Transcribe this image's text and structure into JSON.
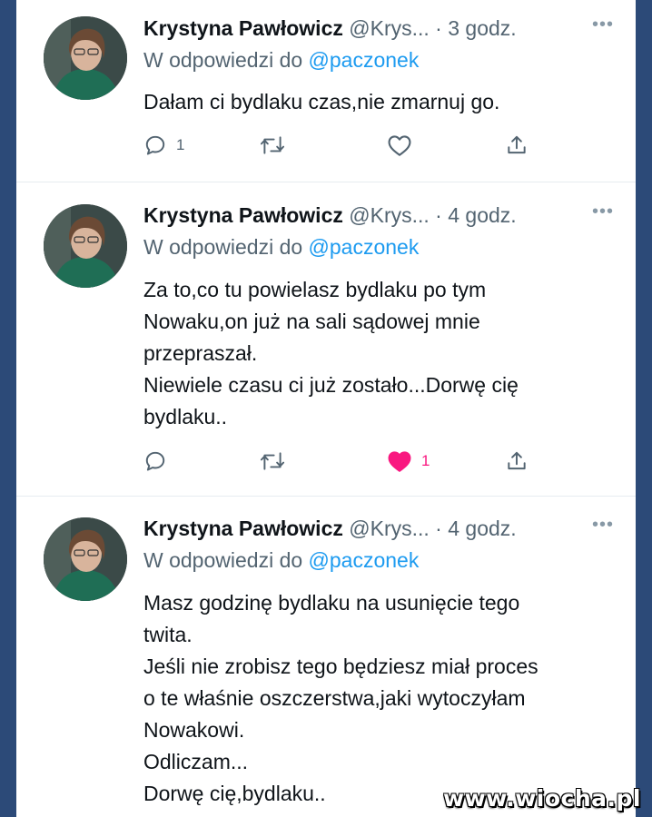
{
  "tweets": [
    {
      "name": "Krystyna Pawłowicz",
      "handle": "@Krys...",
      "time": "· 3 godz.",
      "reply_prefix": "W odpowiedzi do",
      "reply_to": "@paczonek",
      "lines": [
        "Dałam ci bydlaku czas,nie zmarnuj go."
      ],
      "reply_count": "1",
      "like_count": "",
      "liked": false
    },
    {
      "name": "Krystyna Pawłowicz",
      "handle": "@Krys...",
      "time": "· 4 godz.",
      "reply_prefix": "W odpowiedzi do",
      "reply_to": "@paczonek",
      "lines": [
        "Za to,co tu powielasz bydlaku po tym",
        "Nowaku,on już na sali sądowej mnie",
        "przepraszał.",
        "Niewiele czasu ci już zostało...Dorwę cię",
        "bydlaku.."
      ],
      "reply_count": "",
      "like_count": "1",
      "liked": true
    },
    {
      "name": "Krystyna Pawłowicz",
      "handle": "@Krys...",
      "time": "· 4 godz.",
      "reply_prefix": "W odpowiedzi do",
      "reply_to": "@paczonek",
      "lines": [
        "Masz godzinę bydlaku na usunięcie tego",
        "twita.",
        "Jeśli nie zrobisz tego będziesz miał proces",
        "o te właśnie oszczerstwa,jaki wytoczyłam",
        "Nowakowi.",
        "Odliczam...",
        "Dorwę cię,bydlaku.."
      ]
    }
  ],
  "more_icon": "more-dots-icon",
  "icons": [
    "reply-icon",
    "retweet-icon",
    "like-icon",
    "share-icon"
  ],
  "colors": {
    "link": "#1d9bf0",
    "like": "#f91880",
    "muted": "#536471",
    "text": "#0f1419"
  },
  "watermark": "www.wiocha.pl"
}
